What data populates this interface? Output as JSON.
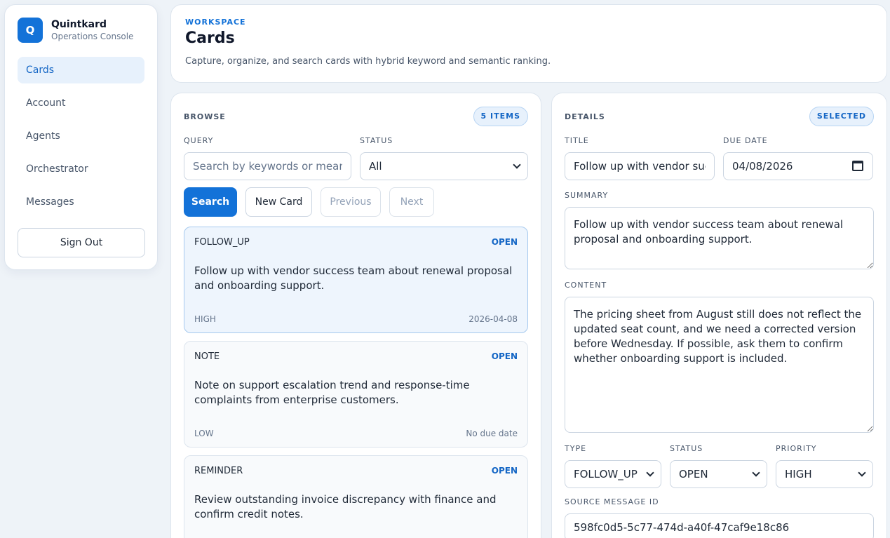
{
  "brand": {
    "logo_letter": "Q",
    "name": "Quintkard",
    "subtitle": "Operations Console"
  },
  "nav": {
    "items": [
      {
        "label": "Cards",
        "active": true
      },
      {
        "label": "Account",
        "active": false
      },
      {
        "label": "Agents",
        "active": false
      },
      {
        "label": "Orchestrator",
        "active": false
      },
      {
        "label": "Messages",
        "active": false
      }
    ],
    "sign_out": "Sign Out"
  },
  "header": {
    "eyebrow": "WORKSPACE",
    "title": "Cards",
    "subtitle": "Capture, organize, and search cards with hybrid keyword and semantic ranking."
  },
  "browse": {
    "title": "BROWSE",
    "badge": "5 ITEMS",
    "query_label": "QUERY",
    "query_placeholder": "Search by keywords or meaning",
    "status_label": "STATUS",
    "status_value": "All",
    "buttons": {
      "search": "Search",
      "new_card": "New Card",
      "previous": "Previous",
      "next": "Next"
    },
    "cards": [
      {
        "type": "FOLLOW_UP",
        "status": "OPEN",
        "text": "Follow up with vendor success team about renewal proposal and onboarding support.",
        "priority": "HIGH",
        "due": "2026-04-08"
      },
      {
        "type": "NOTE",
        "status": "OPEN",
        "text": "Note on support escalation trend and response-time complaints from enterprise customers.",
        "priority": "LOW",
        "due": "No due date"
      },
      {
        "type": "REMINDER",
        "status": "OPEN",
        "text": "Review outstanding invoice discrepancy with finance and confirm credit notes.",
        "priority": "",
        "due": ""
      }
    ]
  },
  "details": {
    "title": "DETAILS",
    "badge": "SELECTED",
    "title_label": "TITLE",
    "title_value": "Follow up with vendor success team",
    "due_label": "DUE DATE",
    "due_value": "04/08/2026",
    "summary_label": "SUMMARY",
    "summary_value": "Follow up with vendor success team about renewal proposal and onboarding support.",
    "content_label": "CONTENT",
    "content_value": "The pricing sheet from August still does not reflect the updated seat count, and we need a corrected version before Wednesday. If possible, ask them to confirm whether onboarding support is included.",
    "type_label": "TYPE",
    "type_value": "FOLLOW_UP",
    "status_label": "STATUS",
    "status_value": "OPEN",
    "priority_label": "PRIORITY",
    "priority_value": "HIGH",
    "source_label": "SOURCE MESSAGE ID",
    "source_value": "598fc0d5-5c77-474d-a40f-47caf9e18c86"
  },
  "colors": {
    "accent": "#1372d8",
    "background": "#eef3f8",
    "active_nav": "#e7f1fc"
  },
  "icons": {
    "date_picker": "calendar-icon",
    "select": "chevron-down-icon"
  }
}
